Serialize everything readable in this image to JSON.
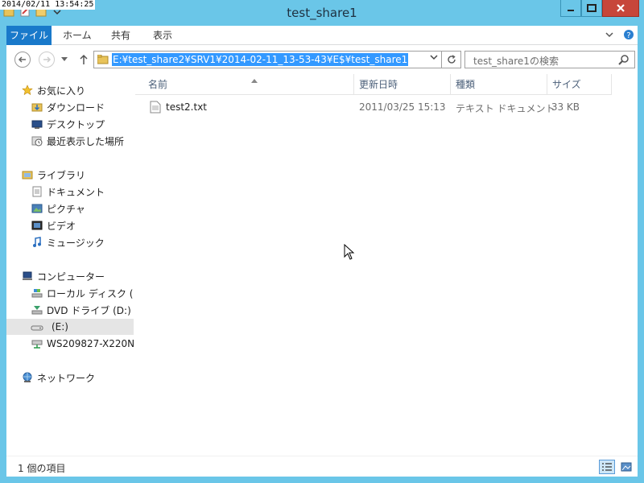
{
  "overlay": {
    "timestamp": "2014/02/11 13:54:25"
  },
  "window": {
    "title": "test_share1"
  },
  "ribbon": {
    "tabs": [
      "ファイル",
      "ホーム",
      "共有",
      "表示"
    ]
  },
  "address": {
    "path": "E:¥test_share2¥SRV1¥2014-02-11_13-53-43¥E$¥test_share1"
  },
  "search": {
    "placeholder": "test_share1の検索"
  },
  "nav": {
    "favorites": {
      "header": "お気に入り",
      "items": [
        "ダウンロード",
        "デスクトップ",
        "最近表示した場所"
      ]
    },
    "libraries": {
      "header": "ライブラリ",
      "items": [
        "ドキュメント",
        "ピクチャ",
        "ビデオ",
        "ミュージック"
      ]
    },
    "computer": {
      "header": "コンピューター",
      "items": [
        "ローカル ディスク (C:)",
        "DVD ドライブ (D:) H",
        "(E:)",
        "WS209827-X220N"
      ]
    },
    "network": {
      "header": "ネットワーク"
    }
  },
  "files": {
    "columns": [
      "名前",
      "更新日時",
      "種類",
      "サイズ"
    ],
    "rows": [
      {
        "name": "test2.txt",
        "modified": "2011/03/25 15:13",
        "type": "テキスト ドキュメント",
        "size": "33 KB"
      }
    ]
  },
  "status": {
    "count": "1 個の項目"
  },
  "colors": {
    "frame": "#6ac6e8",
    "file_tab": "#1979ca",
    "selection": "#3399ff",
    "close": "#c7463a"
  }
}
